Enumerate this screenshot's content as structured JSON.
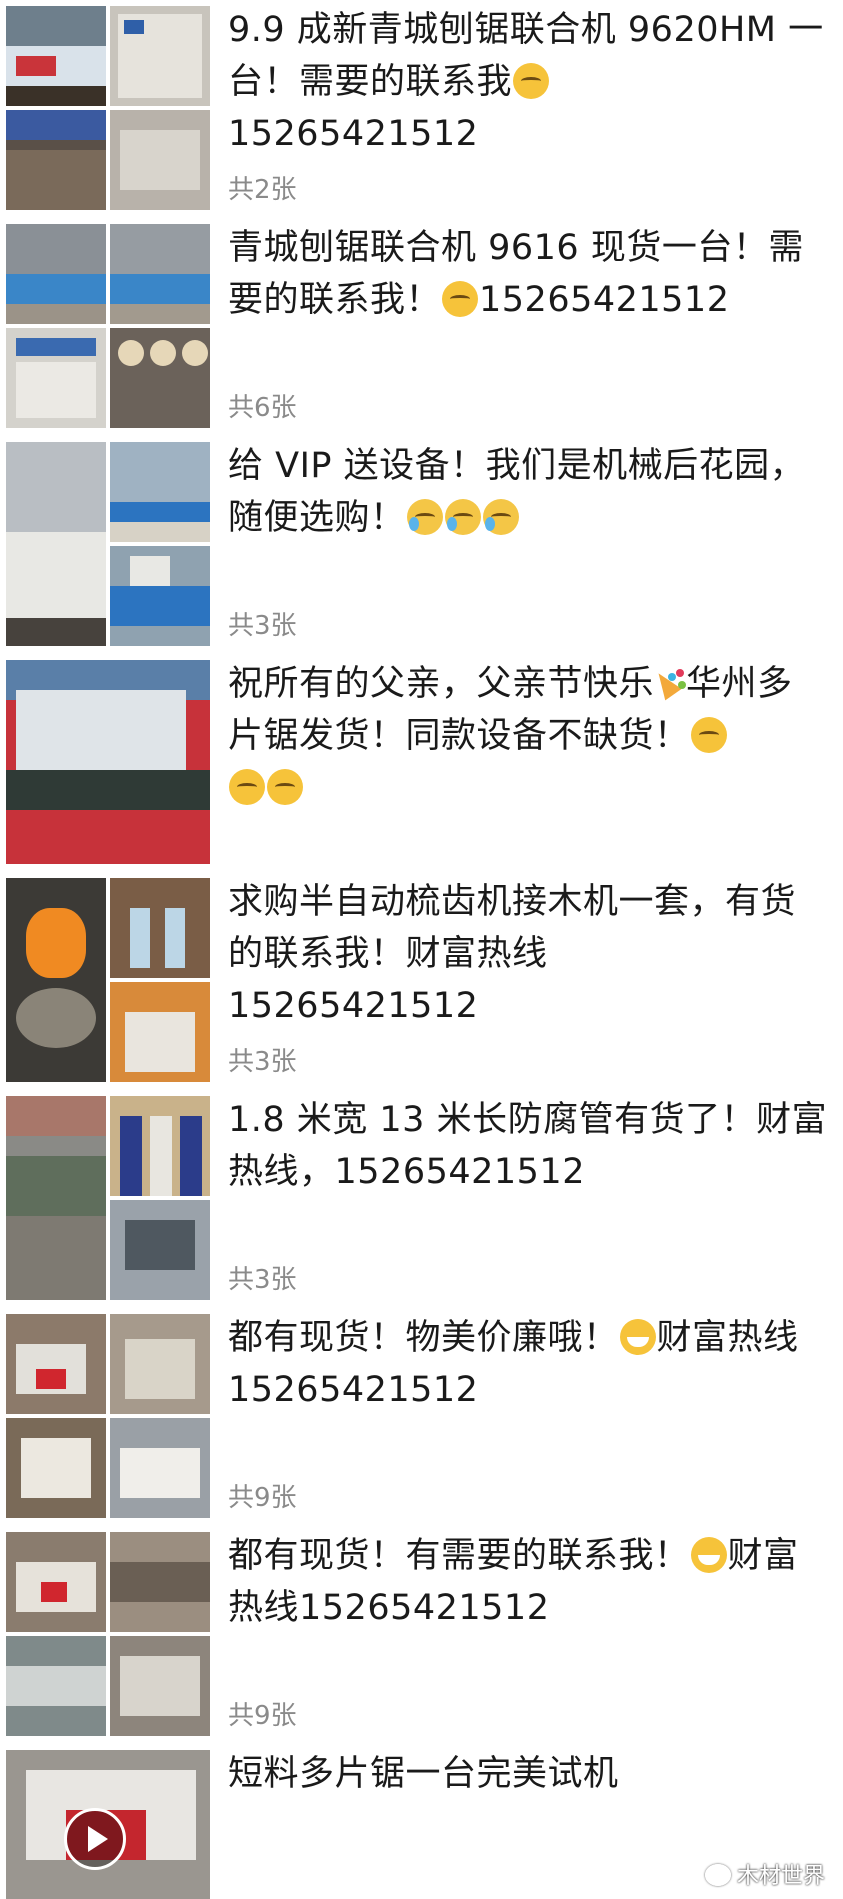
{
  "posts": [
    {
      "text": "9.9 成新青城刨锯联合机 9620HM 一台！需要的联系我",
      "emoji_after": "666",
      "tail": "15265421512",
      "count": "共2张",
      "photos": "grid4"
    },
    {
      "text": "青城刨锯联合机 9616 现货一台！需要的联系我！",
      "emoji_after": "666",
      "tail": "15265421512",
      "count": "共6张",
      "photos": "grid4"
    },
    {
      "text": "给 VIP 送设备！我们是机械后花园，随便选购！",
      "emoji_after": "cry x3",
      "tail": "",
      "count": "共3张",
      "photos": "half"
    },
    {
      "text": "祝所有的父亲，父亲节快乐",
      "emoji_mid": "party",
      "text2": "华州多片锯发货！同款设备不缺货！",
      "emoji_after": "666 x3",
      "count": "",
      "photos": "single"
    },
    {
      "text": "求购半自动梳齿机接木机一套，有货的联系我！财富热线",
      "tail": "15265421512",
      "count": "共3张",
      "photos": "half"
    },
    {
      "text": "1.8 米宽 13 米长防腐管有货了！财富热线，",
      "tail": "15265421512",
      "count": "共3张",
      "photos": "half"
    },
    {
      "text": "都有现货！物美价廉哦！",
      "emoji_mid": "grin",
      "text2": "财富热线",
      "tail": "15265421512",
      "count": "共9张",
      "photos": "grid4"
    },
    {
      "text": "都有现货！有需要的联系我！",
      "emoji_mid": "grin",
      "text2": "财富热线",
      "tail": "15265421512",
      "count": "共9张",
      "photos": "grid4"
    },
    {
      "text": "短料多片锯一台完美试机",
      "count": "",
      "photos": "video"
    }
  ],
  "watermark": "木材世界"
}
